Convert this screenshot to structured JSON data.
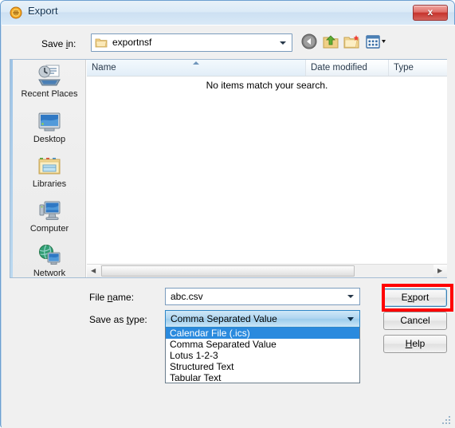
{
  "window": {
    "title": "Export",
    "icon": "lotus-notes-icon",
    "close_label": "x"
  },
  "toolbar": {
    "save_in_label": "Save in:",
    "save_in_value": "exportnsf",
    "save_in_icon": "folder-icon",
    "buttons": [
      {
        "name": "back-button",
        "icon": "back-arrow-icon"
      },
      {
        "name": "up-button",
        "icon": "up-folder-icon"
      },
      {
        "name": "new-folder-button",
        "icon": "new-folder-icon"
      },
      {
        "name": "views-button",
        "icon": "views-icon"
      }
    ]
  },
  "sidebar": {
    "items": [
      {
        "label": "Recent Places",
        "icon": "recent-places-icon"
      },
      {
        "label": "Desktop",
        "icon": "desktop-icon"
      },
      {
        "label": "Libraries",
        "icon": "libraries-icon"
      },
      {
        "label": "Computer",
        "icon": "computer-icon"
      },
      {
        "label": "Network",
        "icon": "network-icon"
      }
    ]
  },
  "filelist": {
    "columns": [
      "Name",
      "Date modified",
      "Type"
    ],
    "rows": [],
    "empty_message": "No items match your search.",
    "sort_column": "Name",
    "sort_direction": "ascending"
  },
  "form": {
    "file_name_label": "File name:",
    "file_name_value": "abc.csv",
    "save_as_type_label": "Save as type:",
    "save_as_type_value": "Comma Separated Value",
    "save_as_type_options": [
      "Calendar File (.ics)",
      "Comma Separated Value",
      "Lotus 1-2-3",
      "Structured Text",
      "Tabular Text"
    ],
    "save_as_type_highlighted": "Calendar File (.ics)"
  },
  "buttons": {
    "export": "Export",
    "cancel": "Cancel",
    "help": "Help"
  },
  "annotation": {
    "highlight_target": "export-button",
    "highlight_color": "#ff0000"
  }
}
